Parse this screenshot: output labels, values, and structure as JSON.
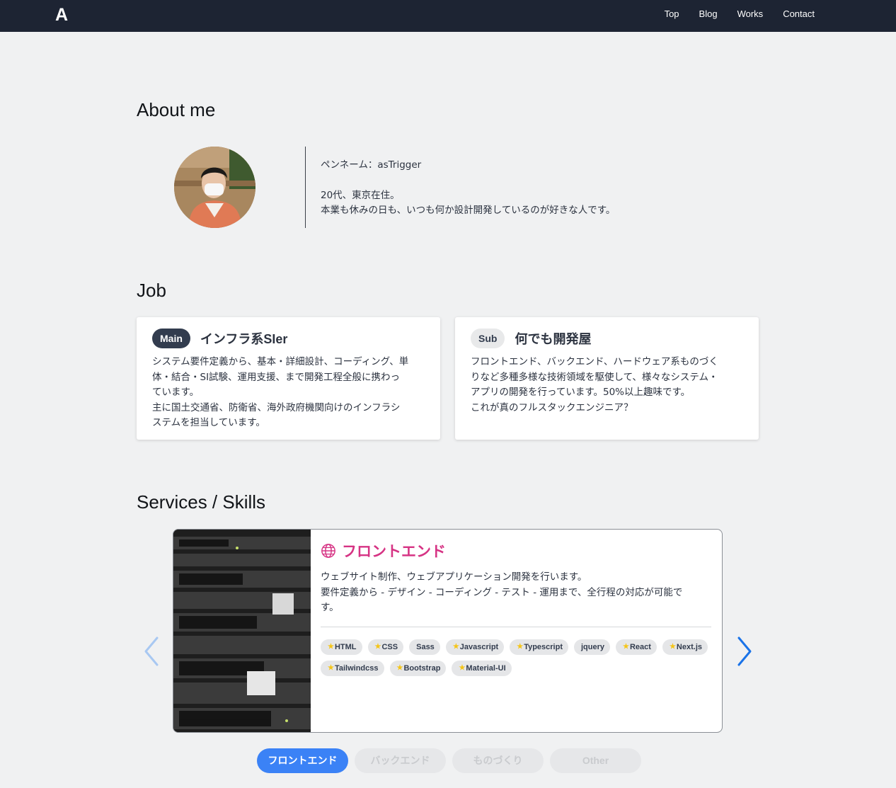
{
  "nav": {
    "logo": "A",
    "links": [
      "Top",
      "Blog",
      "Works",
      "Contact"
    ]
  },
  "about": {
    "heading": "About me",
    "pen_name": "ペンネーム：asTrigger",
    "line1": "20代、東京在住。",
    "line2": "本業も休みの日も、いつも何か設計開発しているのが好きな人です。"
  },
  "job": {
    "heading": "Job",
    "cards": [
      {
        "badge": "Main",
        "title": "インフラ系SIer",
        "lines": [
          "システム要件定義から、基本・詳細設計、コーディング、単",
          "体・結合・SI試験、運用支援、まで開発工程全般に携わっ",
          "ています。",
          "主に国土交通省、防衛省、海外政府機関向けのインフラシ",
          "ステムを担当しています。"
        ]
      },
      {
        "badge": "Sub",
        "title": "何でも開発屋",
        "lines": [
          "フロントエンド、バックエンド、ハードウェア系ものづく",
          "りなど多種多様な技術領域を駆使して、様々なシステム・",
          "アプリの開発を行っています。50%以上趣味です。",
          "これが真のフルスタックエンジニア？"
        ]
      }
    ]
  },
  "skills": {
    "heading": "Services / Skills",
    "slide": {
      "icon": "globe-icon",
      "title": "フロントエンド",
      "desc_lines": [
        "ウェブサイト制作、ウェブアプリケーション開発を行います。",
        "要件定義から - デザイン - コーディング - テスト - 運用まで、全行程の対応が可能で",
        "す。"
      ],
      "tags": [
        {
          "label": "HTML",
          "starred": true
        },
        {
          "label": "CSS",
          "starred": true
        },
        {
          "label": "Sass",
          "starred": false
        },
        {
          "label": "Javascript",
          "starred": true
        },
        {
          "label": "Typescript",
          "starred": true
        },
        {
          "label": "jquery",
          "starred": false
        },
        {
          "label": "React",
          "starred": true
        },
        {
          "label": "Next.js",
          "starred": true
        },
        {
          "label": "Tailwindcss",
          "starred": true
        },
        {
          "label": "Bootstrap",
          "starred": true
        },
        {
          "label": "Material-UI",
          "starred": true
        }
      ]
    },
    "tabs": [
      "フロントエンド",
      "バックエンド",
      "ものづくり",
      "Other"
    ],
    "active_tab": 0,
    "colors": {
      "accent": "#3b82f6",
      "title": "#d63384",
      "arrow_left": "#a8c8f2",
      "arrow_right": "#1a73e8"
    }
  }
}
